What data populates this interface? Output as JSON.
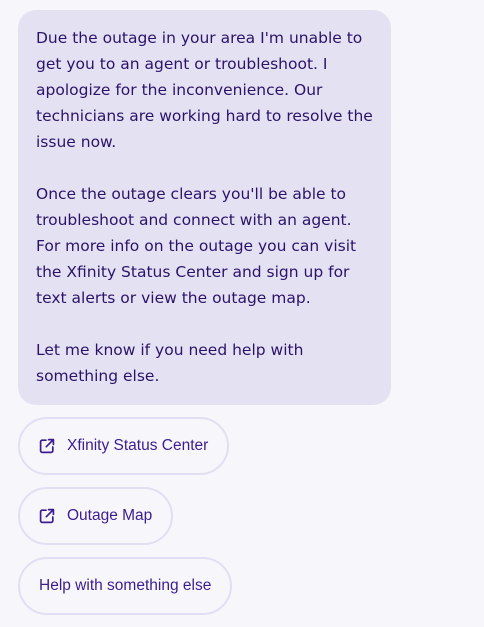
{
  "message": {
    "paragraphs": [
      "Due the outage in your area I'm unable to get you to an agent or troubleshoot. I apologize for the inconvenience. Our technicians are working hard to resolve the issue now.",
      "Once the outage clears you'll be able to troubleshoot and connect with an agent. For more info on the outage you can visit the Xfinity Status Center and sign up for text alerts or view the outage map.",
      "Let me know if you need help with something else."
    ]
  },
  "actions": [
    {
      "label": "Xfinity Status Center",
      "icon": "external-link-icon"
    },
    {
      "label": "Outage Map",
      "icon": "external-link-icon"
    },
    {
      "label": "Help with something else",
      "icon": ""
    }
  ],
  "colors": {
    "bubble_bg": "#e4e1f3",
    "text": "#2b1468",
    "button_text": "#3b1d8f",
    "button_border": "#e3dff3",
    "page_bg": "#f7f6fb"
  }
}
